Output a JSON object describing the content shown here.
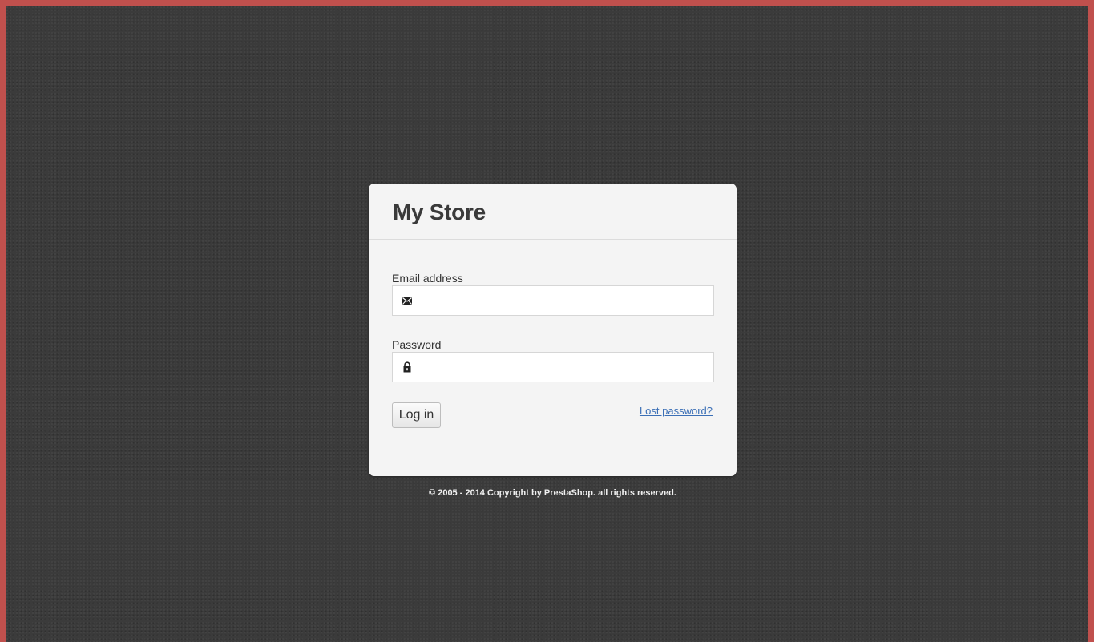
{
  "app": {
    "store_title": "My Store"
  },
  "login_form": {
    "email_label": "Email address",
    "email_value": "",
    "email_icon": "envelope-icon",
    "password_label": "Password",
    "password_value": "",
    "password_icon": "lock-icon",
    "login_button_label": "Log in",
    "lost_password_link": "Lost password?"
  },
  "footer": {
    "copyright": "© 2005 - 2014 Copyright by PrestaShop. all rights reserved."
  },
  "colors": {
    "background": "#3b3b3b",
    "panel": "#f4f4f4",
    "link": "#3b6fb6",
    "frame_border": "#c0504d"
  }
}
